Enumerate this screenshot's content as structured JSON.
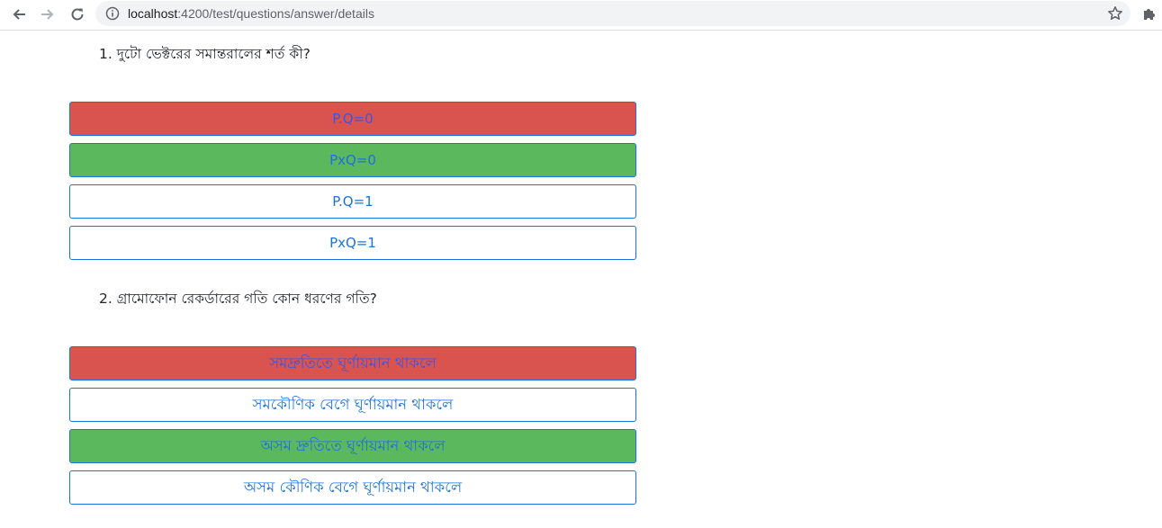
{
  "browser": {
    "url_host": "localhost",
    "url_path": ":4200/test/questions/answer/details"
  },
  "questions": [
    {
      "text": "1. দুটো ভেক্টরের সমান্তরালের শর্ত কী?",
      "options": [
        {
          "label": "P.Q=0",
          "status": "wrong"
        },
        {
          "label": "PxQ=0",
          "status": "correct"
        },
        {
          "label": "P.Q=1",
          "status": "none"
        },
        {
          "label": "PxQ=1",
          "status": "none"
        }
      ]
    },
    {
      "text": "2. গ্রামোফোন রেকর্ডারের গতি কোন ধরণের গতি?",
      "options": [
        {
          "label": "সমদ্রুতিতে ঘূর্ণায়মান থাকলে",
          "status": "wrong"
        },
        {
          "label": "সমকৌণিক বেগে ঘূর্ণায়মান থাকলে",
          "status": "none"
        },
        {
          "label": "অসম দ্রুতিতে ঘূর্ণায়মান থাকলে",
          "status": "correct"
        },
        {
          "label": "অসম কৌণিক বেগে ঘূর্ণায়মান থাকলে",
          "status": "none"
        }
      ]
    }
  ],
  "colors": {
    "wrong": "#d9534f",
    "correct": "#5cb85c",
    "accent": "#1a73d9"
  }
}
